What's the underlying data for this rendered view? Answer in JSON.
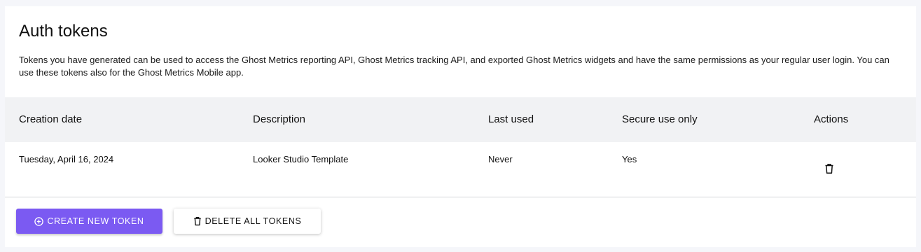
{
  "page": {
    "title": "Auth tokens",
    "description": "Tokens you have generated can be used to access the Ghost Metrics reporting API, Ghost Metrics tracking API, and exported Ghost Metrics widgets and have the same permissions as your regular user login. You can use these tokens also for the Ghost Metrics Mobile app."
  },
  "table": {
    "columns": [
      "Creation date",
      "Description",
      "Last used",
      "Secure use only",
      "Actions"
    ],
    "rows": [
      {
        "creation_date": "Tuesday, April 16, 2024",
        "description": "Looker Studio Template",
        "last_used": "Never",
        "secure_use_only": "Yes",
        "action_icon": "trash-icon"
      }
    ]
  },
  "buttons": {
    "create_label": "CREATE NEW TOKEN",
    "create_icon": "plus-circle-icon",
    "delete_all_label": "DELETE ALL TOKENS",
    "delete_all_icon": "trash-icon"
  },
  "colors": {
    "primary": "#7b5af2",
    "header_bg": "#f1f2f4",
    "page_bg": "#f5f6fa"
  }
}
